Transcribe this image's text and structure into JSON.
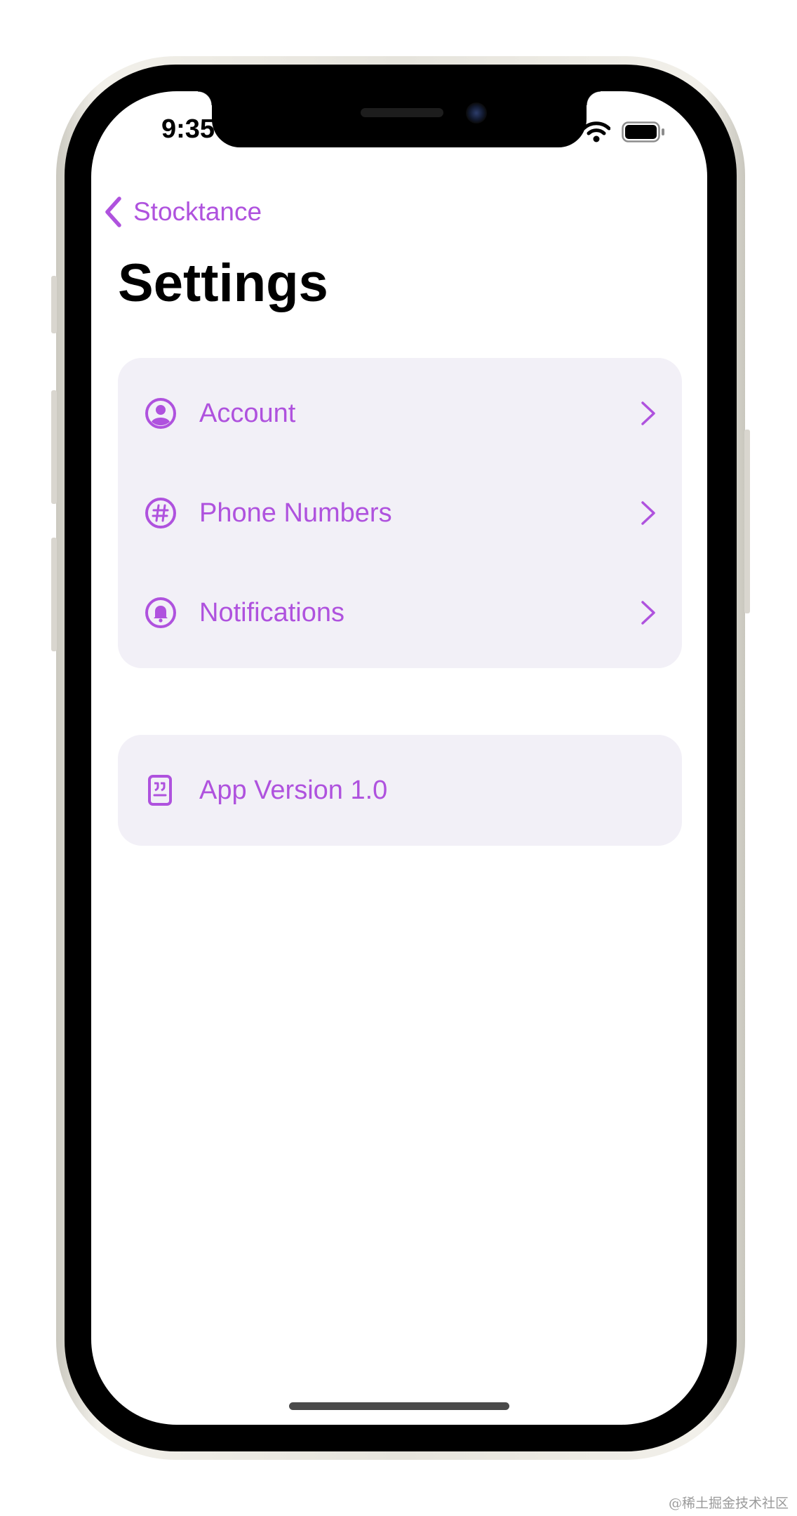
{
  "status_bar": {
    "time": "9:35"
  },
  "navigation": {
    "back_label": "Stocktance"
  },
  "page": {
    "title": "Settings"
  },
  "settings_groups": [
    {
      "rows": [
        {
          "icon": "person-circle-icon",
          "label": "Account"
        },
        {
          "icon": "number-circle-icon",
          "label": "Phone Numbers"
        },
        {
          "icon": "bell-circle-icon",
          "label": "Notifications"
        }
      ]
    },
    {
      "rows": [
        {
          "icon": "quote-bubble-icon",
          "label": "App Version 1.0"
        }
      ]
    }
  ],
  "colors": {
    "accent": "#af52de",
    "group_background": "#f2f0f7",
    "title": "#000000"
  },
  "watermark": "@稀土掘金技术社区"
}
